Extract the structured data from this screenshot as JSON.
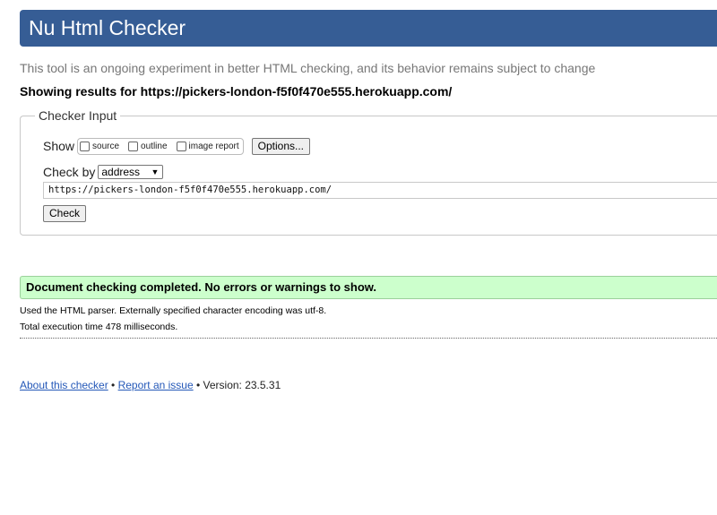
{
  "header": {
    "title": "Nu Html Checker"
  },
  "intro": "This tool is an ongoing experiment in better HTML checking, and its behavior remains subject to change",
  "showing": "Showing results for https://pickers-london-f5f0f470e555.herokuapp.com/",
  "checker_input": {
    "legend": "Checker Input",
    "show_label": "Show",
    "show_options": [
      {
        "label": "source",
        "checked": false
      },
      {
        "label": "outline",
        "checked": false
      },
      {
        "label": "image report",
        "checked": false
      }
    ],
    "options_button": "Options...",
    "check_by_label": "Check by",
    "check_by_value": "address",
    "url_value": "https://pickers-london-f5f0f470e555.herokuapp.com/",
    "check_button": "Check"
  },
  "results": {
    "success": "Document checking completed. No errors or warnings to show.",
    "parser": "Used the HTML parser. Externally specified character encoding was utf-8.",
    "time": "Total execution time 478 milliseconds."
  },
  "footer": {
    "about": "About this checker",
    "sep1": " • ",
    "report": "Report an issue",
    "version": " • Version: 23.5.31"
  },
  "colors": {
    "header_bg": "#365d95",
    "success_bg": "#ccffcc",
    "link": "#2458b8"
  }
}
